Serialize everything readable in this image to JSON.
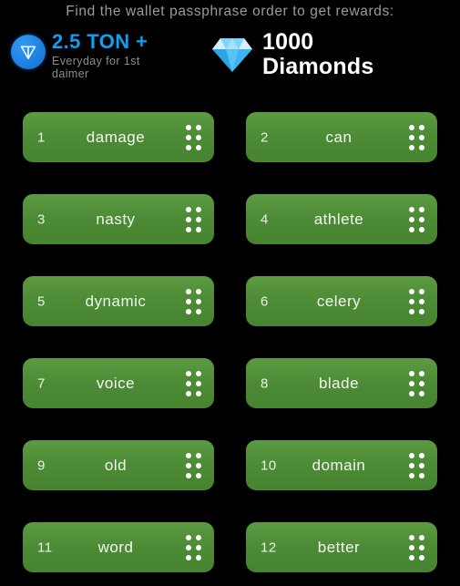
{
  "header": {
    "prompt": "Find the wallet passphrase order to get rewards:"
  },
  "rewards": {
    "ton": {
      "icon": "ton-logo-icon",
      "amount": "2.5 TON +",
      "note": "Everyday for 1st daimer",
      "accent_color": "#0f9ef3"
    },
    "diamonds": {
      "icon": "diamond-gem-icon",
      "count": "1000",
      "label": "Diamonds",
      "accent_color": "#5bc8f5"
    }
  },
  "word_grid": {
    "card_color": "#4d8b36",
    "handle_icon": "drag-handle-dots-icon",
    "cards": [
      {
        "index": "1",
        "word": "damage"
      },
      {
        "index": "2",
        "word": "can"
      },
      {
        "index": "3",
        "word": "nasty"
      },
      {
        "index": "4",
        "word": "athlete"
      },
      {
        "index": "5",
        "word": "dynamic"
      },
      {
        "index": "6",
        "word": "celery"
      },
      {
        "index": "7",
        "word": "voice"
      },
      {
        "index": "8",
        "word": "blade"
      },
      {
        "index": "9",
        "word": "old"
      },
      {
        "index": "10",
        "word": "domain"
      },
      {
        "index": "11",
        "word": "word"
      },
      {
        "index": "12",
        "word": "better"
      }
    ]
  }
}
